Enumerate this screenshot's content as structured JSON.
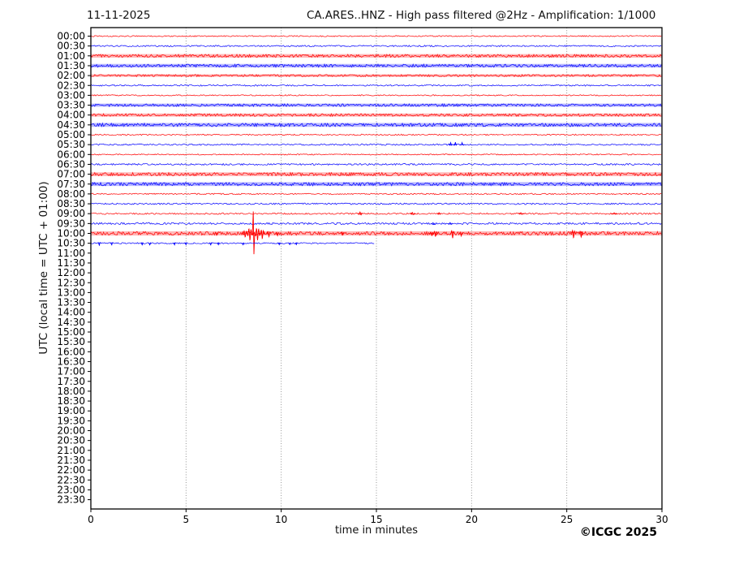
{
  "header": {
    "date": "11-11-2025",
    "title": "CA.ARES..HNZ - High pass filtered @2Hz - Amplification: 1/1000"
  },
  "footer": {
    "copyright": "©ICGC 2025"
  },
  "chart_data": {
    "type": "line",
    "subtype": "helicorder-seismogram",
    "title": "CA.ARES..HNZ - High pass filtered @2Hz - Amplification: 1/1000",
    "date": "11-11-2025",
    "xlabel": "time in minutes",
    "ylabel": "UTC (local time = UTC + 01:00)",
    "xlim": [
      0,
      30
    ],
    "x_ticks": [
      0,
      5,
      10,
      15,
      20,
      25,
      30
    ],
    "grid": "vertical dotted gridlines at 5,10,15,20,25 minutes",
    "legend": "none",
    "colors": {
      "even_trace": "#ff0000",
      "odd_trace": "#0000ff",
      "frame": "#000000",
      "grid": "#888888",
      "background": "#ffffff"
    },
    "row_labels": [
      "00:00",
      "00:30",
      "01:00",
      "01:30",
      "02:00",
      "02:30",
      "03:00",
      "03:30",
      "04:00",
      "04:30",
      "05:00",
      "05:30",
      "06:00",
      "06:30",
      "07:00",
      "07:30",
      "08:00",
      "08:30",
      "09:00",
      "09:30",
      "10:00",
      "10:30",
      "11:00",
      "11:30",
      "12:00",
      "12:30",
      "13:00",
      "13:30",
      "14:00",
      "14:30",
      "15:00",
      "15:30",
      "16:00",
      "16:30",
      "17:00",
      "17:30",
      "18:00",
      "18:30",
      "19:00",
      "19:30",
      "20:00",
      "20:30",
      "21:00",
      "21:30",
      "22:00",
      "22:30",
      "23:00",
      "23:30"
    ],
    "note": "Traces recorded from 00:00 UTC to 10:30 UTC; the 10:30 line stops near minute 14.9; later half-hour lines are empty (no data).",
    "traces": [
      {
        "label": "00:00",
        "color": "#ff0000",
        "noise": 0.7,
        "end": 30,
        "events": []
      },
      {
        "label": "00:30",
        "color": "#0000ff",
        "noise": 0.9,
        "end": 30,
        "events": []
      },
      {
        "label": "01:00",
        "color": "#ff0000",
        "noise": 1.8,
        "end": 30,
        "events": []
      },
      {
        "label": "01:30",
        "color": "#0000ff",
        "noise": 1.8,
        "end": 30,
        "events": []
      },
      {
        "label": "02:00",
        "color": "#ff0000",
        "noise": 1.3,
        "end": 30,
        "events": []
      },
      {
        "label": "02:30",
        "color": "#0000ff",
        "noise": 0.9,
        "end": 30,
        "events": []
      },
      {
        "label": "03:00",
        "color": "#ff0000",
        "noise": 0.7,
        "end": 30,
        "events": []
      },
      {
        "label": "03:30",
        "color": "#0000ff",
        "noise": 1.6,
        "end": 30,
        "events": []
      },
      {
        "label": "04:00",
        "color": "#ff0000",
        "noise": 1.6,
        "end": 30,
        "events": []
      },
      {
        "label": "04:30",
        "color": "#0000ff",
        "noise": 2.0,
        "end": 30,
        "events": []
      },
      {
        "label": "05:00",
        "color": "#ff0000",
        "noise": 0.8,
        "end": 30,
        "events": []
      },
      {
        "label": "05:30",
        "color": "#0000ff",
        "noise": 0.9,
        "end": 30,
        "events": [
          {
            "minute": 18.9,
            "amp": 2.5,
            "width": 0.18
          },
          {
            "minute": 19.15,
            "amp": 3,
            "width": 0.15
          },
          {
            "minute": 19.5,
            "amp": 2.5,
            "width": 0.15
          }
        ]
      },
      {
        "label": "06:00",
        "color": "#ff0000",
        "noise": 0.7,
        "end": 30,
        "events": []
      },
      {
        "label": "06:30",
        "color": "#0000ff",
        "noise": 1.0,
        "end": 30,
        "events": []
      },
      {
        "label": "07:00",
        "color": "#ff0000",
        "noise": 2.0,
        "end": 30,
        "events": []
      },
      {
        "label": "07:30",
        "color": "#0000ff",
        "noise": 2.0,
        "end": 30,
        "events": []
      },
      {
        "label": "08:00",
        "color": "#ff0000",
        "noise": 0.8,
        "end": 30,
        "events": []
      },
      {
        "label": "08:30",
        "color": "#0000ff",
        "noise": 0.9,
        "end": 30,
        "events": []
      },
      {
        "label": "09:00",
        "color": "#ff0000",
        "noise": 0.9,
        "end": 30,
        "events": [
          {
            "minute": 14.15,
            "amp": 2.5,
            "width": 0.3
          },
          {
            "minute": 16.9,
            "amp": 1.8,
            "width": 0.3
          },
          {
            "minute": 18.3,
            "amp": 1.5,
            "width": 0.25
          },
          {
            "minute": 22.6,
            "amp": 1.5,
            "width": 0.3
          },
          {
            "minute": 27.5,
            "amp": 1.3,
            "width": 0.3
          }
        ]
      },
      {
        "label": "09:30",
        "color": "#0000ff",
        "noise": 1.2,
        "end": 30,
        "events": [
          {
            "minute": 18.0,
            "amp": 1.6,
            "width": 0.2
          },
          {
            "minute": 18.9,
            "amp": 1.6,
            "width": 0.2
          }
        ]
      },
      {
        "label": "10:00",
        "color": "#ff0000",
        "noise": 2.2,
        "end": 30,
        "events": [
          {
            "minute": 6.6,
            "amp": 2.5,
            "width": 0.2
          },
          {
            "minute": 8.1,
            "amp": 5,
            "width": 0.3
          },
          {
            "minute": 8.35,
            "amp": 9,
            "width": 0.35
          },
          {
            "minute": 8.55,
            "amp": 27,
            "width": 0.14
          },
          {
            "minute": 8.75,
            "amp": 9,
            "width": 0.4
          },
          {
            "minute": 9.0,
            "amp": 7,
            "width": 0.3
          },
          {
            "minute": 9.35,
            "amp": 4.5,
            "width": 0.25
          },
          {
            "minute": 9.8,
            "amp": 3,
            "width": 0.2
          },
          {
            "minute": 13.2,
            "amp": 2,
            "width": 0.2
          },
          {
            "minute": 17.9,
            "amp": 3,
            "width": 0.25
          },
          {
            "minute": 18.1,
            "amp": 4,
            "width": 0.3
          },
          {
            "minute": 19.0,
            "amp": 6.5,
            "width": 0.25
          },
          {
            "minute": 19.45,
            "amp": 3.5,
            "width": 0.2
          },
          {
            "minute": 25.35,
            "amp": 6,
            "width": 0.3
          },
          {
            "minute": 25.75,
            "amp": 5,
            "width": 0.25
          }
        ]
      },
      {
        "label": "10:30",
        "color": "#0000ff",
        "noise": 0.8,
        "end": 14.9,
        "events": [
          {
            "minute": 0.45,
            "amp": 3,
            "width": 0.12
          },
          {
            "minute": 1.1,
            "amp": 2.5,
            "width": 0.12
          },
          {
            "minute": 2.7,
            "amp": 2.5,
            "width": 0.12
          },
          {
            "minute": 3.1,
            "amp": 2.5,
            "width": 0.12
          },
          {
            "minute": 4.4,
            "amp": 2.5,
            "width": 0.12
          },
          {
            "minute": 5.0,
            "amp": 2.2,
            "width": 0.12
          },
          {
            "minute": 6.3,
            "amp": 2.5,
            "width": 0.12
          },
          {
            "minute": 6.7,
            "amp": 2.2,
            "width": 0.12
          },
          {
            "minute": 8.0,
            "amp": 2.2,
            "width": 0.12
          },
          {
            "minute": 9.9,
            "amp": 2.2,
            "width": 0.12
          },
          {
            "minute": 10.45,
            "amp": 2,
            "width": 0.12
          },
          {
            "minute": 10.8,
            "amp": 2,
            "width": 0.12
          }
        ]
      }
    ]
  }
}
